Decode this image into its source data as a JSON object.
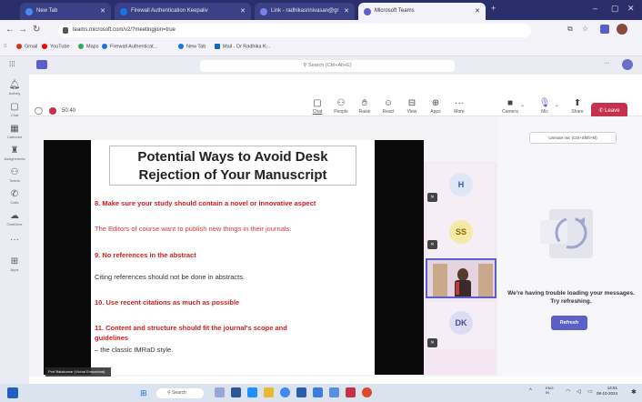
{
  "browser": {
    "tabs": [
      {
        "title": "New Tab",
        "active": false
      },
      {
        "title": "Firewall Authentication Keepaliv",
        "active": false
      },
      {
        "title": "Link - radhikasrinivasan@gr",
        "active": false
      },
      {
        "title": "Microsoft Teams",
        "active": true
      }
    ],
    "url": "teams.microsoft.com/v2/?meetingjoin=true",
    "bookmarks": [
      {
        "label": "Gmail",
        "color": "#d93025"
      },
      {
        "label": "YouTube",
        "color": "#ff0000"
      },
      {
        "label": "Maps",
        "color": "#34a853"
      },
      {
        "label": "Firewall Authenticat...",
        "color": "#1a73e8"
      },
      {
        "label": "New Tab",
        "color": "#1a73e8"
      },
      {
        "label": "Mail - Dr Radhika K...",
        "color": "#0f6cbd"
      }
    ]
  },
  "teams": {
    "search_placeholder": "Search (Ctrl+Alt+E)",
    "rail": [
      "Activity",
      "Chat",
      "Calendar",
      "Assignments",
      "Teams",
      "Calls",
      "OneDrive",
      "",
      "Apps"
    ],
    "meeting": {
      "timer": "50:40",
      "toolbar": [
        {
          "label": "Chat",
          "icon": "chat-icon"
        },
        {
          "label": "People",
          "icon": "people-icon"
        },
        {
          "label": "Raise",
          "icon": "raise-hand-icon"
        },
        {
          "label": "React",
          "icon": "react-icon"
        },
        {
          "label": "View",
          "icon": "view-icon"
        },
        {
          "label": "Apps",
          "icon": "apps-icon"
        },
        {
          "label": "More",
          "icon": "more-icon"
        }
      ],
      "camera_label": "Camera",
      "mic_label": "Mic",
      "share_label": "Share",
      "leave_label": "Leave",
      "mic_tooltip": "Unmute mic (Ctrl+Shift+M)"
    },
    "slide": {
      "title_line1": "Potential Ways to Avoid Desk",
      "title_line2": "Rejection of Your Manuscript",
      "lines": [
        {
          "text": "8. Make sure your study should contain a novel or innovative aspect",
          "style": "red"
        },
        {
          "text": "The Editors of course want to publish new things in their journals.",
          "style": "redlight"
        },
        {
          "text": "9. No references in the abstract",
          "style": "red"
        },
        {
          "text": "Citing references should not be done in abstracts.",
          "style": "dark"
        },
        {
          "text": "10. Use recent citations as much as possible",
          "style": "red"
        },
        {
          "text": "11. Content and structure should fit the journal's scope and",
          "style": "red"
        },
        {
          "text": "guidelines",
          "style": "red"
        },
        {
          "text": "– the classic IMRaD style.",
          "style": "dark"
        }
      ],
      "presenter_label": "Prof Balakumar (Vichai Emsombat)"
    },
    "participants": [
      {
        "initials": "H",
        "bg": "#dfe7f7",
        "fg": "#3a56a8"
      },
      {
        "initials": "SS",
        "bg": "#f6e9a6",
        "fg": "#8a6a00"
      },
      {
        "initials": "DK",
        "bg": "#dcdcf2",
        "fg": "#4a4a8a"
      }
    ],
    "chat_panel": {
      "message": "We're having trouble loading your messages. Try refreshing.",
      "refresh_label": "Refresh"
    }
  },
  "taskbar": {
    "search_label": "Search",
    "lang": "ENG\nIN",
    "time": "14:51",
    "date": "08-10-2024"
  }
}
